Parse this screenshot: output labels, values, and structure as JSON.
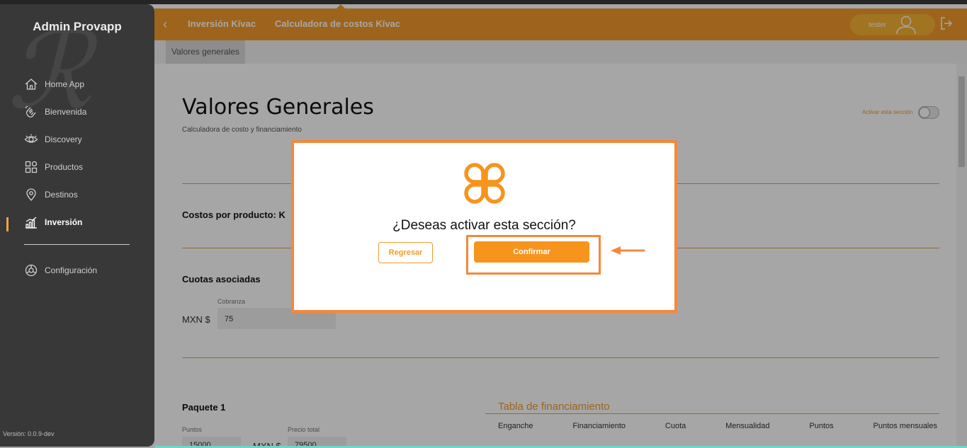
{
  "app": {
    "brand": "Admin Provapp",
    "version": "Versión: 0.0.9-dev"
  },
  "sidebar": {
    "items": [
      {
        "label": "Home App",
        "icon": "home-icon"
      },
      {
        "label": "Bienvenida",
        "icon": "wave-hand-icon"
      },
      {
        "label": "Discovery",
        "icon": "eye-icon"
      },
      {
        "label": "Productos",
        "icon": "grid-icon"
      },
      {
        "label": "Destinos",
        "icon": "location-pin-icon"
      },
      {
        "label": "Inversión",
        "icon": "bar-chart-icon",
        "active": true
      },
      {
        "label": "Configuración",
        "icon": "gear-icon"
      }
    ]
  },
  "header": {
    "breadcrumbs": [
      "Inversión Kívac",
      "Calculadora de costos Kívac"
    ],
    "user": "tester",
    "accent": "#f39a2b"
  },
  "tabs": [
    "Valores generales"
  ],
  "main": {
    "title": "Valores Generales",
    "subtitle": "Calculadora de costo y financiamiento",
    "toggle_label": "Activar esta sección",
    "section_costos": "Costos por producto: K",
    "section_cuotas": "Cuotas asociadas",
    "cobranza_label": "Cobranza",
    "currency": "MXN $",
    "cobranza_value": "75",
    "paquete_title": "Paquete 1",
    "puntos_label": "Puntos",
    "precio_label": "Precio total",
    "puntos_value": "15000",
    "precio_currency": "MXN $",
    "precio_value": "79500",
    "fin_table": {
      "title": "Tabla de financiamiento",
      "columns": [
        "Enganche",
        "Financiamiento",
        "Cuota",
        "Mensualidad",
        "Puntos",
        "Puntos mensuales"
      ]
    }
  },
  "modal": {
    "question": "¿Deseas activar esta sección?",
    "back_label": "Regresar",
    "confirm_label": "Confirmar",
    "brand_color": "#f7941d"
  }
}
